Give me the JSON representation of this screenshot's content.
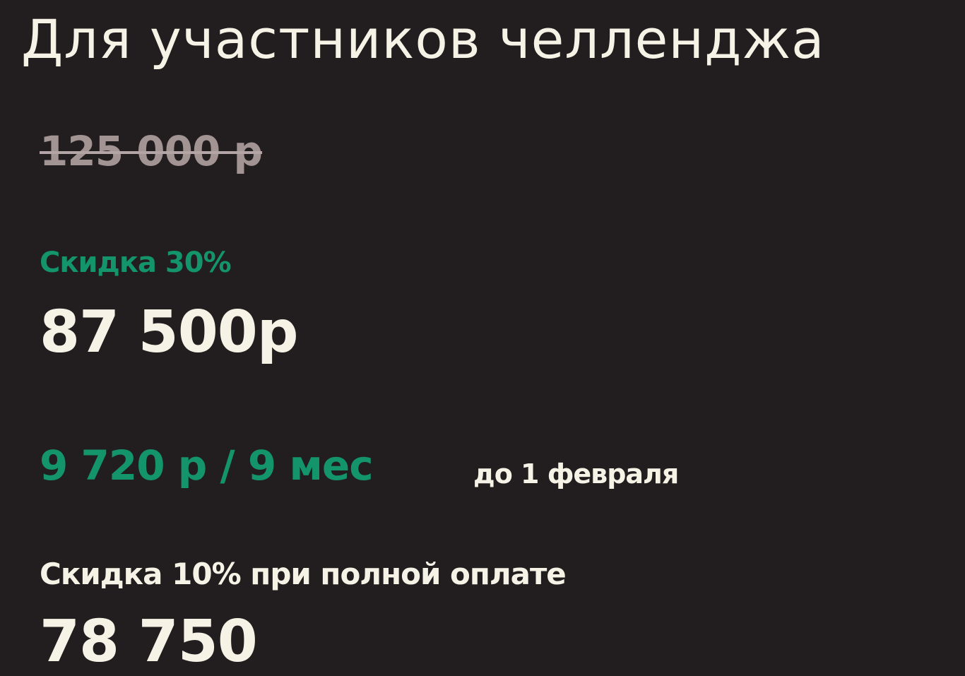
{
  "heading": {
    "title": "Для участников челленджа"
  },
  "pricing": {
    "old_price": "125 000 р",
    "discount_label": "Скидка 30%",
    "discount_price": "87 500р",
    "installment": "9 720 р / 9 мес",
    "deadline": "до 1 февраля",
    "full_payment_label": "Скидка 10% при полной оплате",
    "full_payment_price": "78 750"
  },
  "colors": {
    "background": "#221d1f",
    "text": "#f6f2e6",
    "accent_green": "#13946a",
    "muted": "#a39494"
  }
}
